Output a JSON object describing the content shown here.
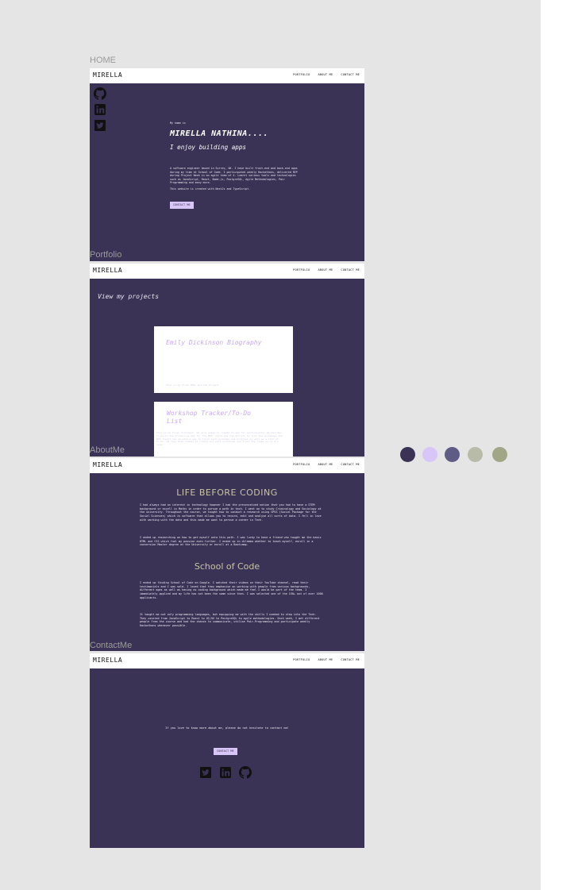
{
  "frames": {
    "home": "HOME",
    "portfolio": "Portfolio",
    "about": "AboutMe",
    "contact": "ContactMe"
  },
  "nav": {
    "logo": "MIRELLA",
    "links": [
      "PORTFOLIO",
      "ABOUT ME",
      "CONTACT ME"
    ]
  },
  "home": {
    "intro": "My name is",
    "name": "MIRELLA NATHINA....",
    "tagline": "I enjoy building apps",
    "bio": "A software engineer based in Surrey, UK. I have built front-end and back-end apps during my time at School of Code. I participated weekly Hackathons, delivered MVP during Project Week in an agile team of 4. Learnt various tools and technologies such as JavaScript, React, Node.js, PostgreSQL, Agile Methodologies, Pair Programming and many more.",
    "built_with": "This website is created with NextJs and TypeScript.",
    "contact_button": "CONTACT ME"
  },
  "portfolio": {
    "heading": "View my projects",
    "projects": [
      {
        "title": "Emily Dickinson Biography",
        "desc": "This is my first HTML and CSS Project"
      },
      {
        "title": "Workshop Tracker/To-Do List",
        "desc": "This is my first fullstack. We were asked to create an app for participants. We decided to build the product as app for the MVP, which has the ability to list the workshops the MVP itself can do with a way to track each workshop and progress as well as a list of To-Do. We have been tasked to create and edit workshops and track the items as we are done."
      }
    ]
  },
  "about": {
    "heading1": "LIFE BEFORE CODING",
    "p1": "I had always had an interest in technology however I had the preconceived notion that you had to have a STEM background or excell in Maths in order to pursue a path in tech. I went on to study Criminology and Sociology at the university. Throughout the course, we taught how to conduct a research using SPSS (Social Package for the Social Sciences) which is software that allows you to record, edit and analyse all sorts of data. I fell in love with working with the data and this made me want to persue a career in Tech.",
    "p2": "I ended up researching on how to get myself onto this path. I was lucky to have a friend who taught me the basic HTML and CSS which fuel my passion even further. I ended up in dilemma whether to teach myself, enroll in a conversion Master degree at the University or enroll at a Bootcamp.",
    "heading2": "School of Code",
    "p3": "I ended up finding School of Code on Google. I watched their videos on their YouTube channel, read their testimonials and I was sold. I loved that they emphasise on working with people from various backgrounds, different ages as well as having no coding background which made me feel I would be part of the team. I immediately applied and my life has not been the same since then. I was selected one of the 150+ out of over 1000 applicants.",
    "p4": "It taught me not only programming languages, but equipping me with the skills I needed to step into the Tech. They covered from JavaScript to React to UI/UX to PostgreSQL to agile methodologies. Each week, I met different people from the course and had the chance to communicate, utilise Pair-Programming and participate weekly Hackathons whenever possible."
  },
  "contact": {
    "message": "If you love to know more about me, please do not hesitate to contact me!",
    "button": "CONTACT ME"
  },
  "icons": {
    "github": "github-icon",
    "linkedin": "linkedin-icon",
    "twitter": "twitter-icon"
  },
  "palette": [
    "#3b3355",
    "#d9c6f8",
    "#5e5b84",
    "#b9bba9",
    "#a1a786"
  ]
}
